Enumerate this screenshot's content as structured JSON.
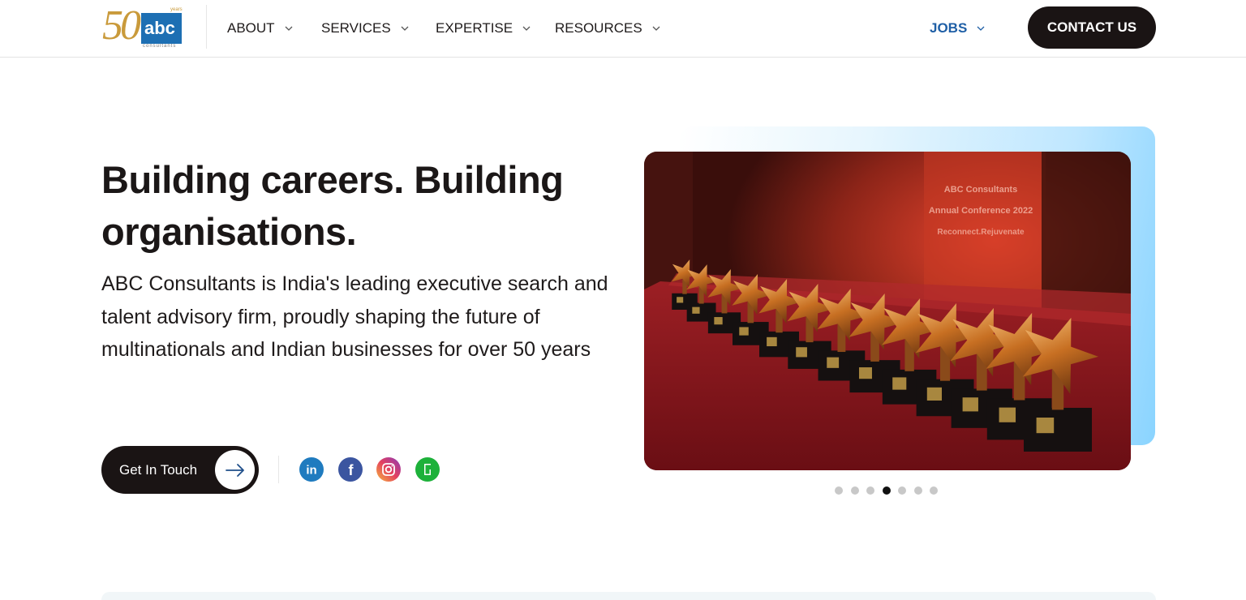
{
  "brand": {
    "logo_number": "50",
    "logo_name": "abc",
    "logo_tag": "years",
    "logo_sub": "consultants"
  },
  "nav": {
    "items": [
      {
        "label": "ABOUT"
      },
      {
        "label": "SERVICES"
      },
      {
        "label": "EXPERTISE"
      },
      {
        "label": "RESOURCES"
      }
    ],
    "jobs_label": "JOBS",
    "contact_label": "CONTACT US"
  },
  "hero": {
    "title": "Building careers. Building organisations.",
    "description": "ABC Consultants is India's leading executive search and talent advisory firm, proudly shaping the future of multinationals and Indian businesses for over 50 years",
    "cta_label": "Get In Touch"
  },
  "photo": {
    "banner_line1": "ABC Consultants",
    "banner_line2": "Annual Conference 2022",
    "banner_line3": "Reconnect.Rejuvenate"
  },
  "carousel": {
    "slide_count": 7,
    "active_index": 3
  },
  "colors": {
    "dark": "#1a1414",
    "jobs_blue": "#1f5fa6",
    "linkedin": "#1f7bbf",
    "facebook": "#3b55a0",
    "glassdoor": "#1db13a"
  }
}
